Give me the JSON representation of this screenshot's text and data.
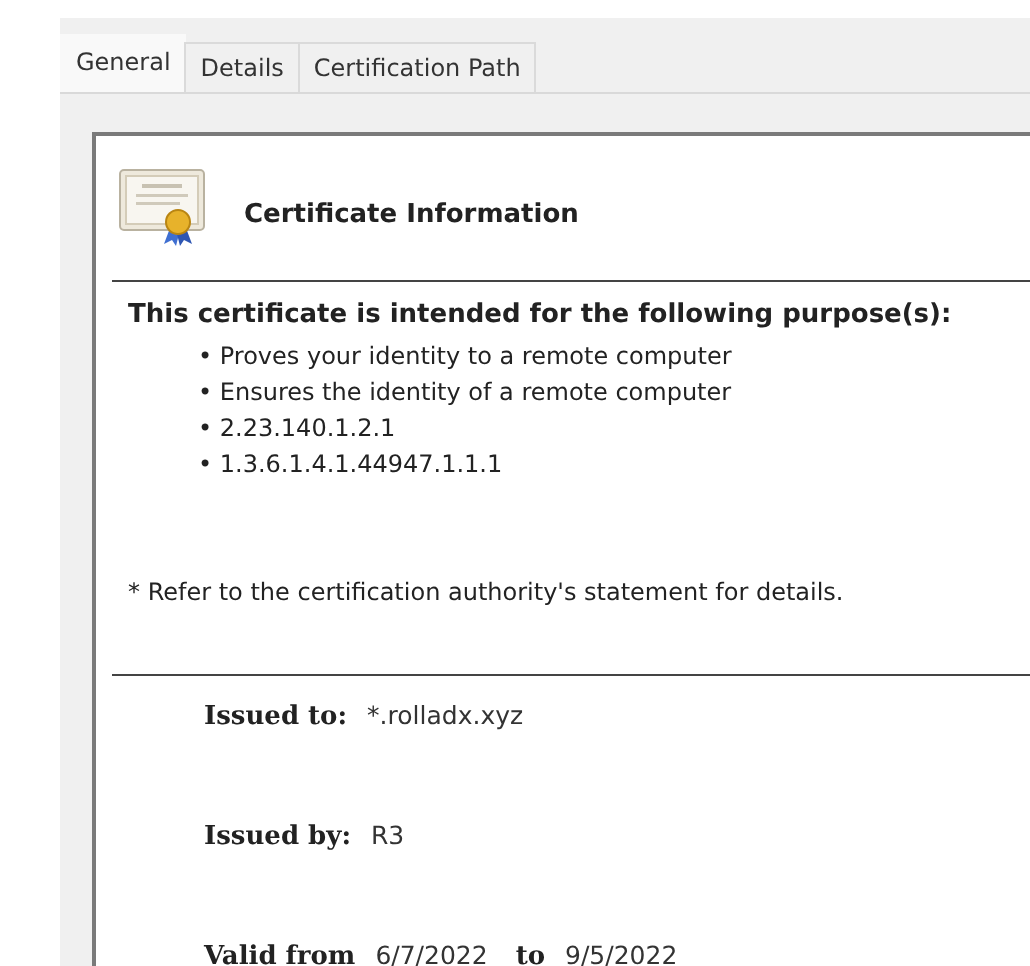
{
  "tabs": [
    {
      "label": "General",
      "selected": true
    },
    {
      "label": "Details",
      "selected": false
    },
    {
      "label": "Certification Path",
      "selected": false
    }
  ],
  "header": {
    "title": "Certificate Information"
  },
  "purpose": {
    "heading": "This certificate is intended for the following purpose(s):",
    "items": [
      "• Proves your identity to a remote computer",
      "• Ensures the identity of a remote computer",
      "• 2.23.140.1.2.1",
      "• 1.3.6.1.4.1.44947.1.1.1"
    ],
    "note": "* Refer to the certification authority's statement for details."
  },
  "issued_to": {
    "label": "Issued to:",
    "value": "*.rolladx.xyz"
  },
  "issued_by": {
    "label": "Issued by:",
    "value": "R3"
  },
  "validity": {
    "from_label": "Valid from",
    "from": "6/7/2022",
    "to_label": "to",
    "to": "9/5/2022"
  }
}
